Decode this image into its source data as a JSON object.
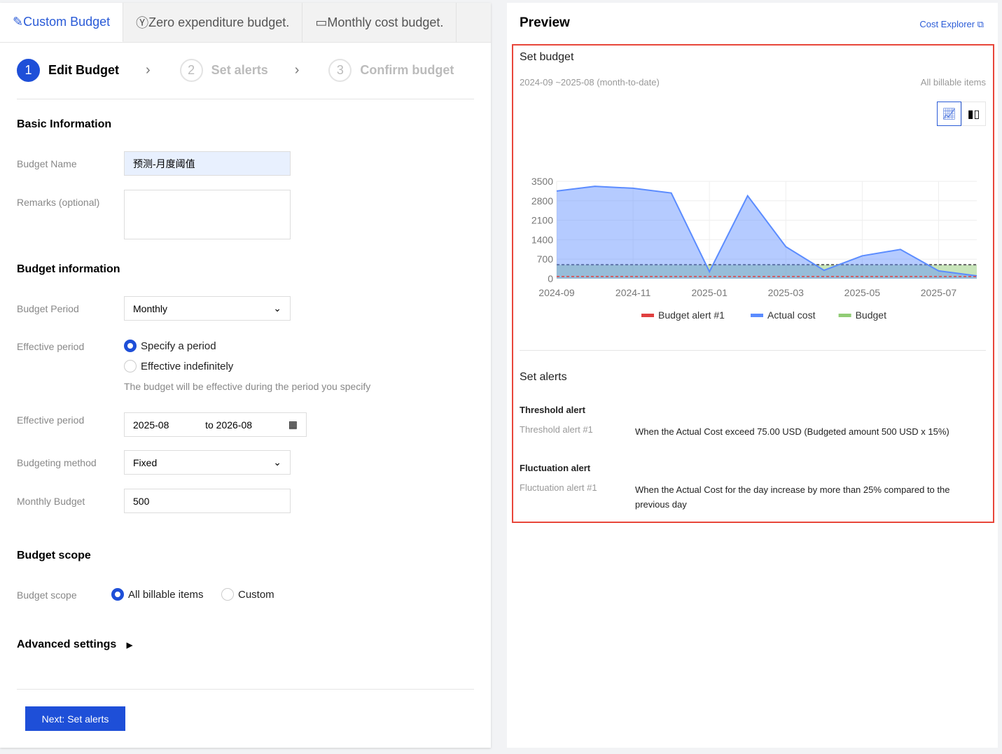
{
  "tabs": [
    "Custom Budget",
    "Zero expenditure budget.",
    "Monthly cost budget."
  ],
  "steps": [
    {
      "n": "1",
      "label": "Edit Budget"
    },
    {
      "n": "2",
      "label": "Set alerts"
    },
    {
      "n": "3",
      "label": "Confirm budget"
    }
  ],
  "basic": {
    "title": "Basic Information",
    "name_label": "Budget Name",
    "name_value": "预测-月度阈值",
    "remarks_label": "Remarks (optional)"
  },
  "budget": {
    "title": "Budget information",
    "period_label": "Budget Period",
    "period_value": "Monthly",
    "effective_label": "Effective period",
    "opt1": "Specify a period",
    "opt2": "Effective indefinitely",
    "hint": "The budget will be effective during the period you specify",
    "range_label": "Effective period",
    "range_from": "2025-08",
    "range_to": "to 2026-08",
    "method_label": "Budgeting method",
    "method_value": "Fixed",
    "monthly_label": "Monthly Budget",
    "monthly_value": "500"
  },
  "scope": {
    "title": "Budget scope",
    "label": "Budget scope",
    "opt1": "All billable items",
    "opt2": "Custom"
  },
  "advanced": "Advanced settings",
  "next_button": "Next: Set alerts",
  "preview": {
    "title": "Preview",
    "cost_explorer": "Cost Explorer",
    "set_budget": "Set budget",
    "range": "2024-09 ~2025-08 (month-to-date)",
    "scope": "All billable items",
    "set_alerts": "Set alerts",
    "threshold_title": "Threshold alert",
    "threshold_name": "Threshold alert #1",
    "threshold_text": "When the Actual Cost exceed 75.00 USD (Budgeted amount 500 USD x 15%)",
    "fluct_title": "Fluctuation alert",
    "fluct_name": "Fluctuation alert #1",
    "fluct_text": "When the Actual Cost for the day increase by more than 25% compared to the previous day"
  },
  "chart_data": {
    "type": "area",
    "x": [
      "2024-09",
      "2024-10",
      "2024-11",
      "2024-12",
      "2025-01",
      "2025-02",
      "2025-03",
      "2025-04",
      "2025-05",
      "2025-06",
      "2025-07",
      "2025-08"
    ],
    "xticks": [
      "2024-09",
      "2024-11",
      "2025-01",
      "2025-03",
      "2025-05",
      "2025-07"
    ],
    "yticks": [
      "3500",
      "2800",
      "2100",
      "1400",
      "700",
      "0"
    ],
    "ylim": [
      0,
      3500
    ],
    "series": [
      {
        "name": "Budget alert #1",
        "color": "#e04040",
        "values": [
          75,
          75,
          75,
          75,
          75,
          75,
          75,
          75,
          75,
          75,
          75,
          75
        ]
      },
      {
        "name": "Actual cost",
        "color": "#5b8cff",
        "values": [
          3150,
          3320,
          3250,
          3080,
          250,
          2980,
          1150,
          300,
          820,
          1050,
          280,
          100
        ]
      },
      {
        "name": "Budget",
        "color": "#91cc75",
        "values": [
          500,
          500,
          500,
          500,
          500,
          500,
          500,
          500,
          500,
          500,
          500,
          500
        ]
      }
    ]
  }
}
